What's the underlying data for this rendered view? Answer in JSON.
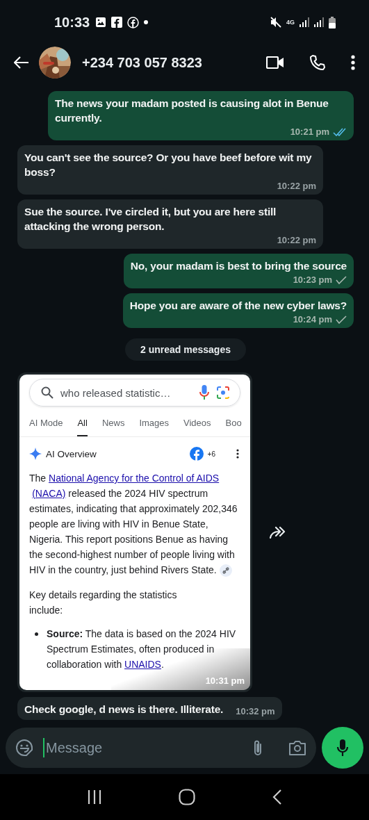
{
  "status_bar": {
    "time": "10:33",
    "network": "4G"
  },
  "header": {
    "contact": "+234 703 057 8323"
  },
  "messages": [
    {
      "kind": "outgoing",
      "text": "The news your madam posted is causing alot in Benue currently.",
      "time": "10:21 pm",
      "read": true
    },
    {
      "kind": "incoming",
      "text": "You can't see the source? Or you have beef before wit my boss?",
      "time": "10:22 pm"
    },
    {
      "kind": "incoming",
      "text": "Sue the source. I've circled it, but you are here still attacking the wrong person.",
      "time": "10:22 pm"
    },
    {
      "kind": "outgoing",
      "text": "No, your madam is best to bring the source",
      "time": "10:23 pm",
      "read": false
    },
    {
      "kind": "outgoing",
      "text": "Hope you are aware of the new cyber laws?",
      "time": "10:24 pm",
      "read": false
    },
    {
      "kind": "divider",
      "text": "2 unread messages"
    },
    {
      "kind": "screenshot",
      "time": "10:31 pm",
      "screenshot": {
        "query": "who released statistic…",
        "tabs": [
          {
            "label": "AI Mode",
            "selected": false
          },
          {
            "label": "All",
            "selected": true
          },
          {
            "label": "News",
            "selected": false
          },
          {
            "label": "Images",
            "selected": false
          },
          {
            "label": "Videos",
            "selected": false
          },
          {
            "label": "Boo",
            "selected": false
          }
        ],
        "overview": {
          "title": "AI Overview",
          "source_count": "+6",
          "paragraph": [
            {
              "kind": "text",
              "text": "The "
            },
            {
              "kind": "link",
              "text": "National Agency for the Control of AIDS"
            },
            {
              "kind": "link",
              "text": "(NACA)"
            },
            {
              "kind": "text",
              "text": " released the 2024 HIV spectrum estimates, indicating that approximately 202,346 people are living with HIV in Benue State, Nigeria. This report positions Benue as having the second-highest number of people living with HIV in the country, just behind Rivers State."
            }
          ],
          "intro": "Key details regarding the statistics include:",
          "bullets": [
            {
              "parts": [
                {
                  "kind": "text",
                  "text": "**Source:** The data is based on the 2024 HIV Spectrum Estimates, often produced in collaboration with "
                },
                {
                  "kind": "link",
                  "text": "UNAIDS"
                },
                {
                  "kind": "text",
                  "text": "."
                }
              ]
            }
          ]
        }
      }
    },
    {
      "kind": "incoming",
      "text": "Check google, d news is there. Illiterate.",
      "time": "10:32 pm"
    }
  ],
  "composer": {
    "placeholder": "Message"
  }
}
